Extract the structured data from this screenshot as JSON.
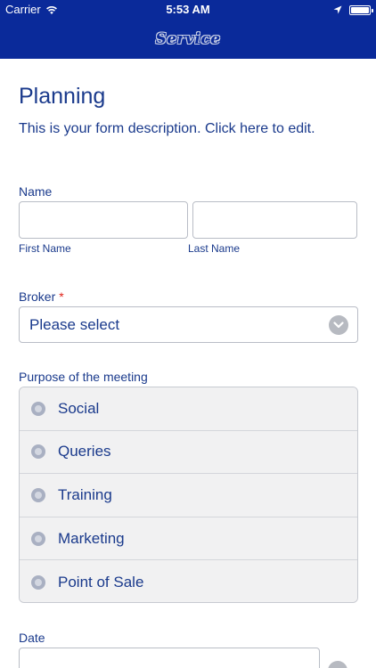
{
  "status_bar": {
    "carrier": "Carrier",
    "time": "5:53 AM"
  },
  "nav": {
    "title": "Service"
  },
  "form": {
    "title": "Planning",
    "description": "This is your form description. Click here to edit.",
    "name": {
      "label": "Name",
      "first_sublabel": "First Name",
      "last_sublabel": "Last Name",
      "first_value": "",
      "last_value": ""
    },
    "broker": {
      "label": "Broker",
      "required_mark": "*",
      "selected": "Please select"
    },
    "purpose": {
      "label": "Purpose of the meeting",
      "options": [
        "Social",
        "Queries",
        "Training",
        "Marketing",
        "Point of Sale"
      ]
    },
    "date": {
      "label": "Date",
      "value": ""
    }
  },
  "icons": {
    "wifi": "wifi-icon",
    "location": "location-arrow-icon",
    "battery": "battery-icon",
    "select_chevron": "chevron-down-icon",
    "calendar": "calendar-icon"
  },
  "colors": {
    "brand_blue": "#0a2a9a",
    "text_blue": "#1a3a8c",
    "required_red": "#e0241b"
  }
}
